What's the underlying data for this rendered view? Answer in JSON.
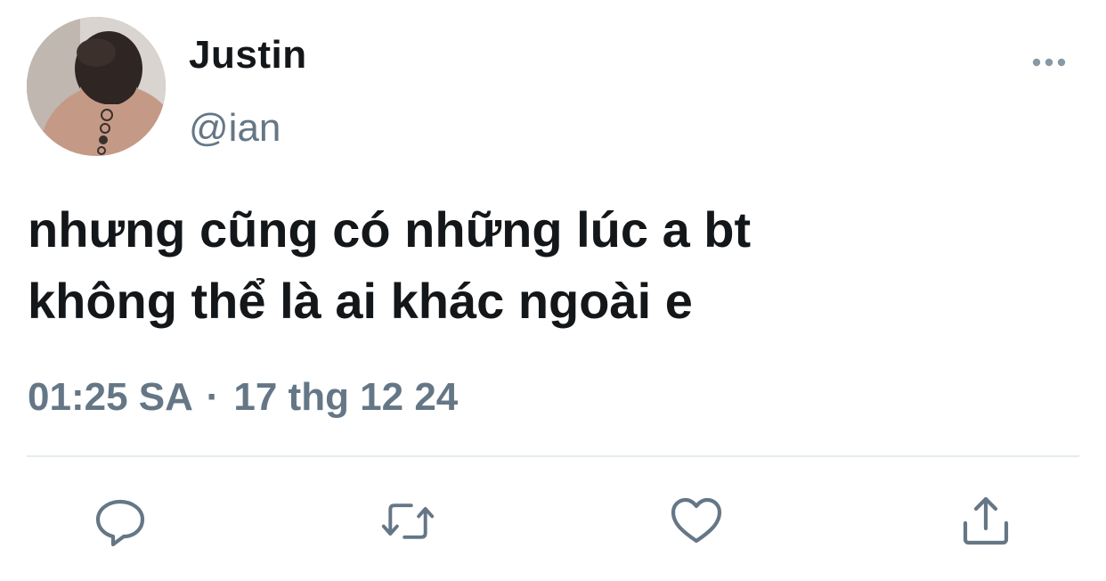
{
  "tweet": {
    "author": {
      "display_name": "Justin",
      "handle": "@ian"
    },
    "text_lines": [
      "nhưng cũng có những lúc a bt",
      "không thể là ai khác ngoài e"
    ],
    "time": "01:25 SA",
    "separator": "·",
    "date": "17 thg 12 24"
  },
  "actions": [
    {
      "name": "reply",
      "icon": "reply-icon"
    },
    {
      "name": "retweet",
      "icon": "retweet-icon"
    },
    {
      "name": "like",
      "icon": "heart-icon"
    },
    {
      "name": "share",
      "icon": "share-icon"
    }
  ],
  "colors": {
    "text": "#14171a",
    "secondary": "#657786",
    "icon": "#657786",
    "divider": "#e6ecf0"
  }
}
